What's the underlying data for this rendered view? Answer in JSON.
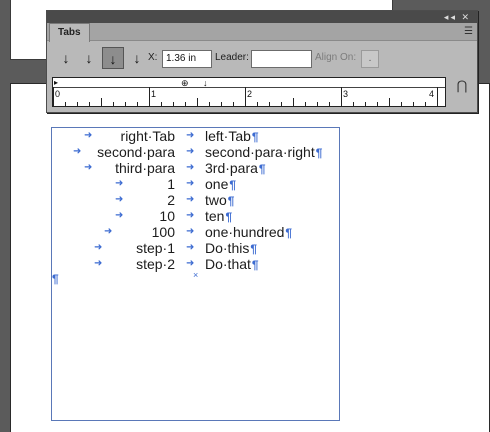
{
  "panel": {
    "tab_label": "Tabs",
    "window_controls": "◂◂ ✕",
    "menu_icon": "hamburger-icon",
    "x_label": "X:",
    "x_value": "1.36 in",
    "leader_label": "Leader:",
    "leader_value": "",
    "align_on_label": "Align On:",
    "align_on_value": ".",
    "ruler_numbers": [
      "0",
      "1",
      "2",
      "3",
      "4"
    ]
  },
  "document": {
    "rows": [
      {
        "right": "right·Tab",
        "left": "left·Tab"
      },
      {
        "right": "second·para",
        "left": "second·para·right"
      },
      {
        "right": "third·para",
        "left": "3rd·para"
      },
      {
        "right": "1",
        "left": "one"
      },
      {
        "right": "2",
        "left": "two"
      },
      {
        "right": "10",
        "left": "ten"
      },
      {
        "right": "100",
        "left": "one·hundred"
      },
      {
        "right": "step·1",
        "left": "Do·this"
      },
      {
        "right": "step·2",
        "left": "Do·that"
      }
    ],
    "pilcrow": "¶",
    "tab_arrow": "➜",
    "overset_mark": "×"
  },
  "colors": {
    "pasteboard": "#5b5b5b",
    "frame_border": "#5a78b8",
    "hidden_chars": "#3c6bd1",
    "panel_bg": "#b9b9b9"
  }
}
